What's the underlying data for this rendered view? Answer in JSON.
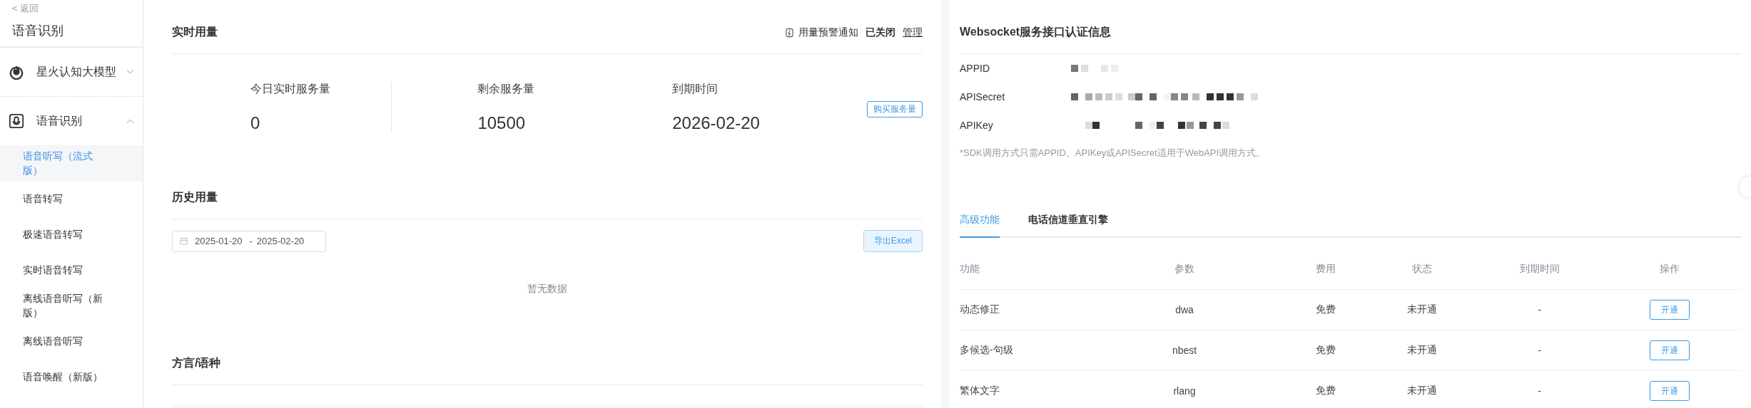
{
  "sidebar": {
    "back": "< 返回",
    "title": "语音识别",
    "groups": [
      {
        "label": "星火认知大模型",
        "expanded": false
      },
      {
        "label": "语音识别",
        "expanded": true,
        "items": [
          {
            "label": "语音听写（流式版）",
            "selected": true
          },
          {
            "label": "语音转写",
            "selected": false
          },
          {
            "label": "极速语音转写",
            "selected": false
          },
          {
            "label": "实时语音转写",
            "selected": false
          },
          {
            "label": "离线语音听写（新版）",
            "selected": false
          },
          {
            "label": "离线语音听写",
            "selected": false
          },
          {
            "label": "语音唤醒（新版）",
            "selected": false
          }
        ]
      }
    ]
  },
  "realtime": {
    "title": "实时用量",
    "alert_label": "用量预警通知",
    "alert_state": "已关闭",
    "manage": "管理",
    "stats": [
      {
        "label": "今日实时服务量",
        "value": "0"
      },
      {
        "label": "剩余服务量",
        "value": "10500"
      },
      {
        "label": "到期时间",
        "value": "2026-02-20"
      }
    ],
    "buy_button": "购买服务量"
  },
  "history": {
    "title": "历史用量",
    "date_start": "2025-01-20",
    "date_sep": "-",
    "date_end": "2025-02-20",
    "export_button": "导出Excel",
    "empty": "暂无数据"
  },
  "dialect": {
    "title": "方言/语种"
  },
  "auth": {
    "title": "Websocket服务接口认证信息",
    "fields": [
      {
        "label": "APPID"
      },
      {
        "label": "APISecret"
      },
      {
        "label": "APIKey"
      }
    ],
    "note": "*SDK调用方式只需APPID。APIKey或APISecret适用于WebAPI调用方式。"
  },
  "tabs": [
    {
      "label": "高级功能",
      "selected": true
    },
    {
      "label": "电话信道垂直引擎",
      "selected": false
    }
  ],
  "table": {
    "columns": [
      "功能",
      "参数",
      "费用",
      "状态",
      "到期时间",
      "操作"
    ],
    "rows": [
      {
        "name": "动态修正",
        "param": "dwa",
        "fee": "免费",
        "status": "未开通",
        "expiry": "-",
        "action": "开通"
      },
      {
        "name": "多候选-句级",
        "param": "nbest",
        "fee": "免费",
        "status": "未开通",
        "expiry": "-",
        "action": "开通"
      },
      {
        "name": "繁体文字",
        "param": "rlang",
        "fee": "免费",
        "status": "未开通",
        "expiry": "-",
        "action": "开通"
      }
    ]
  }
}
